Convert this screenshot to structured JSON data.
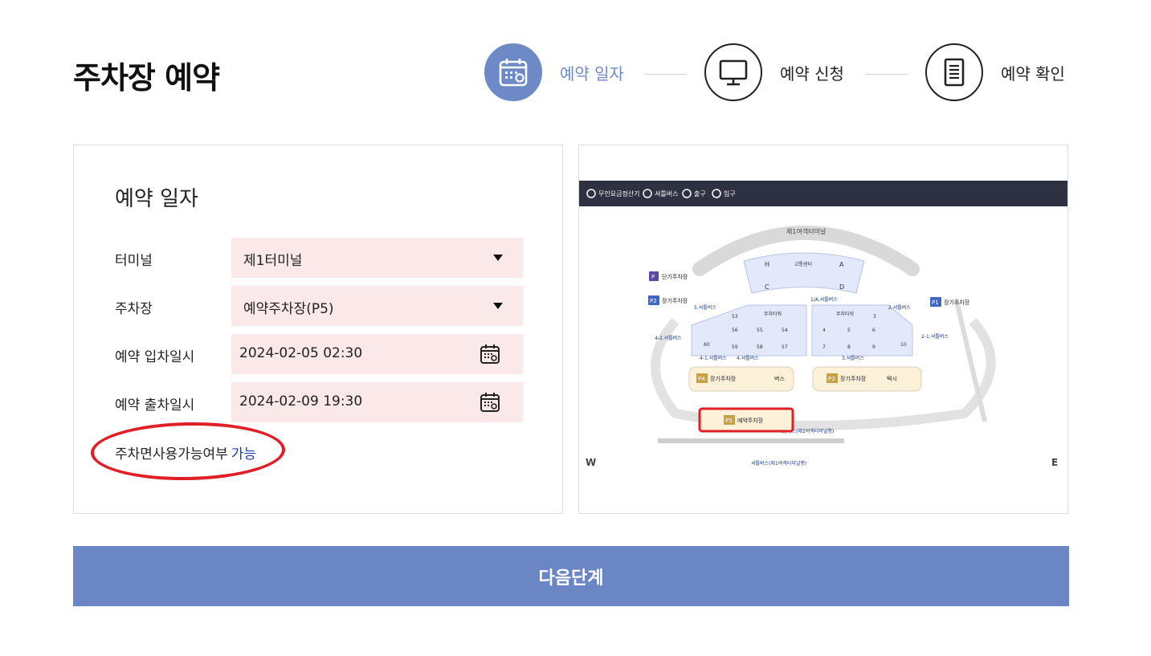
{
  "page": {
    "title": "주차장 예약"
  },
  "steps": [
    {
      "label": "예약 일자",
      "active": true
    },
    {
      "label": "예약 신청",
      "active": false
    },
    {
      "label": "예약 확인",
      "active": false
    }
  ],
  "form": {
    "section_title": "예약 일자",
    "terminal": {
      "label": "터미널",
      "value": "제1터미널"
    },
    "parking_lot": {
      "label": "주차장",
      "value": "예약주차장(P5)"
    },
    "entry": {
      "label": "예약 입차일시",
      "value": "2024-02-05 02:30"
    },
    "exit": {
      "label": "예약 출차일시",
      "value": "2024-02-09 19:30"
    },
    "availability": {
      "label": "주차면사용가능여부",
      "value": "가능"
    }
  },
  "map": {
    "legend": [
      "무인요금정산기",
      "셔틀버스",
      "출구",
      "입구"
    ],
    "terminal_label": "제1여객터미널",
    "transport_center": "교통센터",
    "gates": [
      "H",
      "A",
      "C",
      "D"
    ],
    "short_term": {
      "badge": "P",
      "label": "단기주차장"
    },
    "p2": {
      "badge": "P2",
      "label": "장기주차장"
    },
    "p1": {
      "badge": "P1",
      "label": "장기주차장"
    },
    "p4": {
      "badge": "P4",
      "label": "장기주차장",
      "side": "버스"
    },
    "p3": {
      "badge": "P3",
      "label": "장기주차장",
      "side": "택시"
    },
    "p5": {
      "badge": "P5",
      "label": "예약주차장"
    },
    "towers": [
      "주차타워",
      "주차타워"
    ],
    "zones_left": [
      "53",
      "56",
      "55",
      "54",
      "60",
      "59",
      "58",
      "57"
    ],
    "zones_right": [
      "3",
      "4",
      "5",
      "6",
      "7",
      "8",
      "9",
      "10"
    ],
    "shuttles": [
      "5.셔틀버스",
      "1/A.셔틀버스",
      "2.셔틀버스",
      "4-2.셔틀버스",
      "2-1.셔틀버스",
      "4-1.셔틀버스",
      "4.셔틀버스",
      "3.셔틀버스",
      "셔틀버스(제2여객터미널행)",
      "셔틀버스(제1여객터미널행)"
    ],
    "compass": {
      "west": "W",
      "east": "E"
    },
    "colors": {
      "header_bar": "#2e3142",
      "highlight": "#e11f26",
      "lot_fill": "#fdf1d9",
      "tower_fill": "#e3e8fb"
    }
  },
  "actions": {
    "next_label": "다음단계"
  },
  "colors": {
    "accent": "#6d8ac6",
    "field_bg": "#fbe8e8",
    "button": "#6b86c4",
    "available": "#1f3bb3"
  }
}
